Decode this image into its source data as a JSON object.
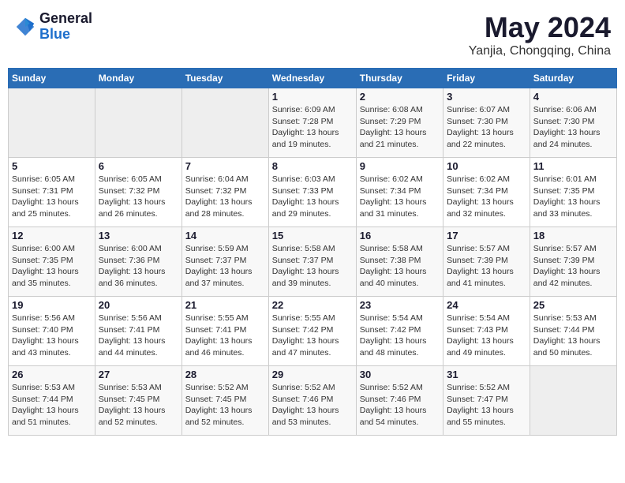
{
  "header": {
    "logo_general": "General",
    "logo_blue": "Blue",
    "title": "May 2024",
    "location": "Yanjia, Chongqing, China"
  },
  "weekdays": [
    "Sunday",
    "Monday",
    "Tuesday",
    "Wednesday",
    "Thursday",
    "Friday",
    "Saturday"
  ],
  "weeks": [
    [
      {
        "day": "",
        "info": ""
      },
      {
        "day": "",
        "info": ""
      },
      {
        "day": "",
        "info": ""
      },
      {
        "day": "1",
        "info": "Sunrise: 6:09 AM\nSunset: 7:28 PM\nDaylight: 13 hours\nand 19 minutes."
      },
      {
        "day": "2",
        "info": "Sunrise: 6:08 AM\nSunset: 7:29 PM\nDaylight: 13 hours\nand 21 minutes."
      },
      {
        "day": "3",
        "info": "Sunrise: 6:07 AM\nSunset: 7:30 PM\nDaylight: 13 hours\nand 22 minutes."
      },
      {
        "day": "4",
        "info": "Sunrise: 6:06 AM\nSunset: 7:30 PM\nDaylight: 13 hours\nand 24 minutes."
      }
    ],
    [
      {
        "day": "5",
        "info": "Sunrise: 6:05 AM\nSunset: 7:31 PM\nDaylight: 13 hours\nand 25 minutes."
      },
      {
        "day": "6",
        "info": "Sunrise: 6:05 AM\nSunset: 7:32 PM\nDaylight: 13 hours\nand 26 minutes."
      },
      {
        "day": "7",
        "info": "Sunrise: 6:04 AM\nSunset: 7:32 PM\nDaylight: 13 hours\nand 28 minutes."
      },
      {
        "day": "8",
        "info": "Sunrise: 6:03 AM\nSunset: 7:33 PM\nDaylight: 13 hours\nand 29 minutes."
      },
      {
        "day": "9",
        "info": "Sunrise: 6:02 AM\nSunset: 7:34 PM\nDaylight: 13 hours\nand 31 minutes."
      },
      {
        "day": "10",
        "info": "Sunrise: 6:02 AM\nSunset: 7:34 PM\nDaylight: 13 hours\nand 32 minutes."
      },
      {
        "day": "11",
        "info": "Sunrise: 6:01 AM\nSunset: 7:35 PM\nDaylight: 13 hours\nand 33 minutes."
      }
    ],
    [
      {
        "day": "12",
        "info": "Sunrise: 6:00 AM\nSunset: 7:35 PM\nDaylight: 13 hours\nand 35 minutes."
      },
      {
        "day": "13",
        "info": "Sunrise: 6:00 AM\nSunset: 7:36 PM\nDaylight: 13 hours\nand 36 minutes."
      },
      {
        "day": "14",
        "info": "Sunrise: 5:59 AM\nSunset: 7:37 PM\nDaylight: 13 hours\nand 37 minutes."
      },
      {
        "day": "15",
        "info": "Sunrise: 5:58 AM\nSunset: 7:37 PM\nDaylight: 13 hours\nand 39 minutes."
      },
      {
        "day": "16",
        "info": "Sunrise: 5:58 AM\nSunset: 7:38 PM\nDaylight: 13 hours\nand 40 minutes."
      },
      {
        "day": "17",
        "info": "Sunrise: 5:57 AM\nSunset: 7:39 PM\nDaylight: 13 hours\nand 41 minutes."
      },
      {
        "day": "18",
        "info": "Sunrise: 5:57 AM\nSunset: 7:39 PM\nDaylight: 13 hours\nand 42 minutes."
      }
    ],
    [
      {
        "day": "19",
        "info": "Sunrise: 5:56 AM\nSunset: 7:40 PM\nDaylight: 13 hours\nand 43 minutes."
      },
      {
        "day": "20",
        "info": "Sunrise: 5:56 AM\nSunset: 7:41 PM\nDaylight: 13 hours\nand 44 minutes."
      },
      {
        "day": "21",
        "info": "Sunrise: 5:55 AM\nSunset: 7:41 PM\nDaylight: 13 hours\nand 46 minutes."
      },
      {
        "day": "22",
        "info": "Sunrise: 5:55 AM\nSunset: 7:42 PM\nDaylight: 13 hours\nand 47 minutes."
      },
      {
        "day": "23",
        "info": "Sunrise: 5:54 AM\nSunset: 7:42 PM\nDaylight: 13 hours\nand 48 minutes."
      },
      {
        "day": "24",
        "info": "Sunrise: 5:54 AM\nSunset: 7:43 PM\nDaylight: 13 hours\nand 49 minutes."
      },
      {
        "day": "25",
        "info": "Sunrise: 5:53 AM\nSunset: 7:44 PM\nDaylight: 13 hours\nand 50 minutes."
      }
    ],
    [
      {
        "day": "26",
        "info": "Sunrise: 5:53 AM\nSunset: 7:44 PM\nDaylight: 13 hours\nand 51 minutes."
      },
      {
        "day": "27",
        "info": "Sunrise: 5:53 AM\nSunset: 7:45 PM\nDaylight: 13 hours\nand 52 minutes."
      },
      {
        "day": "28",
        "info": "Sunrise: 5:52 AM\nSunset: 7:45 PM\nDaylight: 13 hours\nand 52 minutes."
      },
      {
        "day": "29",
        "info": "Sunrise: 5:52 AM\nSunset: 7:46 PM\nDaylight: 13 hours\nand 53 minutes."
      },
      {
        "day": "30",
        "info": "Sunrise: 5:52 AM\nSunset: 7:46 PM\nDaylight: 13 hours\nand 54 minutes."
      },
      {
        "day": "31",
        "info": "Sunrise: 5:52 AM\nSunset: 7:47 PM\nDaylight: 13 hours\nand 55 minutes."
      },
      {
        "day": "",
        "info": ""
      }
    ]
  ]
}
